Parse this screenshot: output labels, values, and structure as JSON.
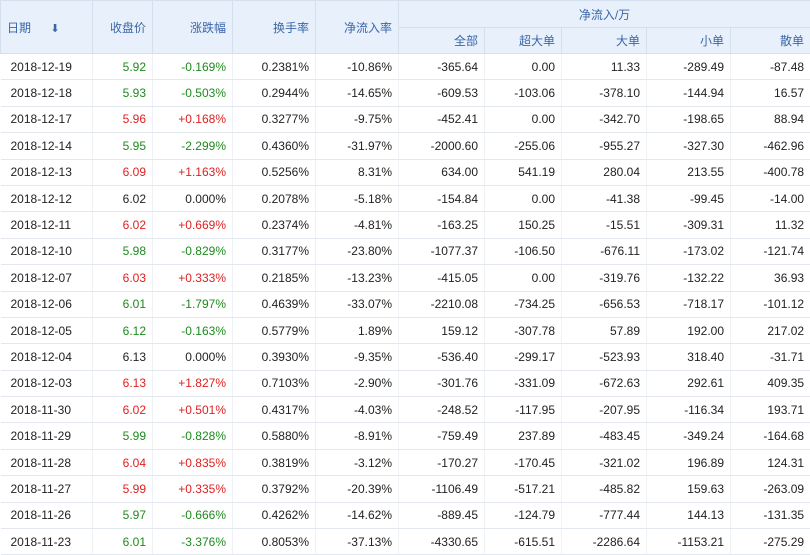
{
  "header": {
    "date": "日期",
    "close": "收盘价",
    "change": "涨跌幅",
    "turnover": "换手率",
    "net_inflow_rate": "净流入率",
    "net_inflow_group": "净流入/万",
    "total": "全部",
    "super_large": "超大单",
    "large": "大单",
    "small": "小单",
    "retail": "散单",
    "sort_icon": "⬇"
  },
  "rows": [
    {
      "date": "2018-12-19",
      "close": "5.92",
      "change": "-0.169%",
      "turnover": "0.2381%",
      "rate": "-10.86%",
      "total": "-365.64",
      "super": "0.00",
      "large": "11.33",
      "small": "-289.49",
      "retail": "-87.48",
      "dir": "down"
    },
    {
      "date": "2018-12-18",
      "close": "5.93",
      "change": "-0.503%",
      "turnover": "0.2944%",
      "rate": "-14.65%",
      "total": "-609.53",
      "super": "-103.06",
      "large": "-378.10",
      "small": "-144.94",
      "retail": "16.57",
      "dir": "down"
    },
    {
      "date": "2018-12-17",
      "close": "5.96",
      "change": "+0.168%",
      "turnover": "0.3277%",
      "rate": "-9.75%",
      "total": "-452.41",
      "super": "0.00",
      "large": "-342.70",
      "small": "-198.65",
      "retail": "88.94",
      "dir": "up"
    },
    {
      "date": "2018-12-14",
      "close": "5.95",
      "change": "-2.299%",
      "turnover": "0.4360%",
      "rate": "-31.97%",
      "total": "-2000.60",
      "super": "-255.06",
      "large": "-955.27",
      "small": "-327.30",
      "retail": "-462.96",
      "dir": "down"
    },
    {
      "date": "2018-12-13",
      "close": "6.09",
      "change": "+1.163%",
      "turnover": "0.5256%",
      "rate": "8.31%",
      "total": "634.00",
      "super": "541.19",
      "large": "280.04",
      "small": "213.55",
      "retail": "-400.78",
      "dir": "up"
    },
    {
      "date": "2018-12-12",
      "close": "6.02",
      "change": "0.000%",
      "turnover": "0.2078%",
      "rate": "-5.18%",
      "total": "-154.84",
      "super": "0.00",
      "large": "-41.38",
      "small": "-99.45",
      "retail": "-14.00",
      "dir": "flat"
    },
    {
      "date": "2018-12-11",
      "close": "6.02",
      "change": "+0.669%",
      "turnover": "0.2374%",
      "rate": "-4.81%",
      "total": "-163.25",
      "super": "150.25",
      "large": "-15.51",
      "small": "-309.31",
      "retail": "11.32",
      "dir": "up"
    },
    {
      "date": "2018-12-10",
      "close": "5.98",
      "change": "-0.829%",
      "turnover": "0.3177%",
      "rate": "-23.80%",
      "total": "-1077.37",
      "super": "-106.50",
      "large": "-676.11",
      "small": "-173.02",
      "retail": "-121.74",
      "dir": "down"
    },
    {
      "date": "2018-12-07",
      "close": "6.03",
      "change": "+0.333%",
      "turnover": "0.2185%",
      "rate": "-13.23%",
      "total": "-415.05",
      "super": "0.00",
      "large": "-319.76",
      "small": "-132.22",
      "retail": "36.93",
      "dir": "up"
    },
    {
      "date": "2018-12-06",
      "close": "6.01",
      "change": "-1.797%",
      "turnover": "0.4639%",
      "rate": "-33.07%",
      "total": "-2210.08",
      "super": "-734.25",
      "large": "-656.53",
      "small": "-718.17",
      "retail": "-101.12",
      "dir": "down"
    },
    {
      "date": "2018-12-05",
      "close": "6.12",
      "change": "-0.163%",
      "turnover": "0.5779%",
      "rate": "1.89%",
      "total": "159.12",
      "super": "-307.78",
      "large": "57.89",
      "small": "192.00",
      "retail": "217.02",
      "dir": "down"
    },
    {
      "date": "2018-12-04",
      "close": "6.13",
      "change": "0.000%",
      "turnover": "0.3930%",
      "rate": "-9.35%",
      "total": "-536.40",
      "super": "-299.17",
      "large": "-523.93",
      "small": "318.40",
      "retail": "-31.71",
      "dir": "flat"
    },
    {
      "date": "2018-12-03",
      "close": "6.13",
      "change": "+1.827%",
      "turnover": "0.7103%",
      "rate": "-2.90%",
      "total": "-301.76",
      "super": "-331.09",
      "large": "-672.63",
      "small": "292.61",
      "retail": "409.35",
      "dir": "up"
    },
    {
      "date": "2018-11-30",
      "close": "6.02",
      "change": "+0.501%",
      "turnover": "0.4317%",
      "rate": "-4.03%",
      "total": "-248.52",
      "super": "-117.95",
      "large": "-207.95",
      "small": "-116.34",
      "retail": "193.71",
      "dir": "up"
    },
    {
      "date": "2018-11-29",
      "close": "5.99",
      "change": "-0.828%",
      "turnover": "0.5880%",
      "rate": "-8.91%",
      "total": "-759.49",
      "super": "237.89",
      "large": "-483.45",
      "small": "-349.24",
      "retail": "-164.68",
      "dir": "down"
    },
    {
      "date": "2018-11-28",
      "close": "6.04",
      "change": "+0.835%",
      "turnover": "0.3819%",
      "rate": "-3.12%",
      "total": "-170.27",
      "super": "-170.45",
      "large": "-321.02",
      "small": "196.89",
      "retail": "124.31",
      "dir": "up"
    },
    {
      "date": "2018-11-27",
      "close": "5.99",
      "change": "+0.335%",
      "turnover": "0.3792%",
      "rate": "-20.39%",
      "total": "-1106.49",
      "super": "-517.21",
      "large": "-485.82",
      "small": "159.63",
      "retail": "-263.09",
      "dir": "up"
    },
    {
      "date": "2018-11-26",
      "close": "5.97",
      "change": "-0.666%",
      "turnover": "0.4262%",
      "rate": "-14.62%",
      "total": "-889.45",
      "super": "-124.79",
      "large": "-777.44",
      "small": "144.13",
      "retail": "-131.35",
      "dir": "down"
    },
    {
      "date": "2018-11-23",
      "close": "6.01",
      "change": "-3.376%",
      "turnover": "0.8053%",
      "rate": "-37.13%",
      "total": "-4330.65",
      "super": "-615.51",
      "large": "-2286.64",
      "small": "-1153.21",
      "retail": "-275.29",
      "dir": "down"
    }
  ]
}
